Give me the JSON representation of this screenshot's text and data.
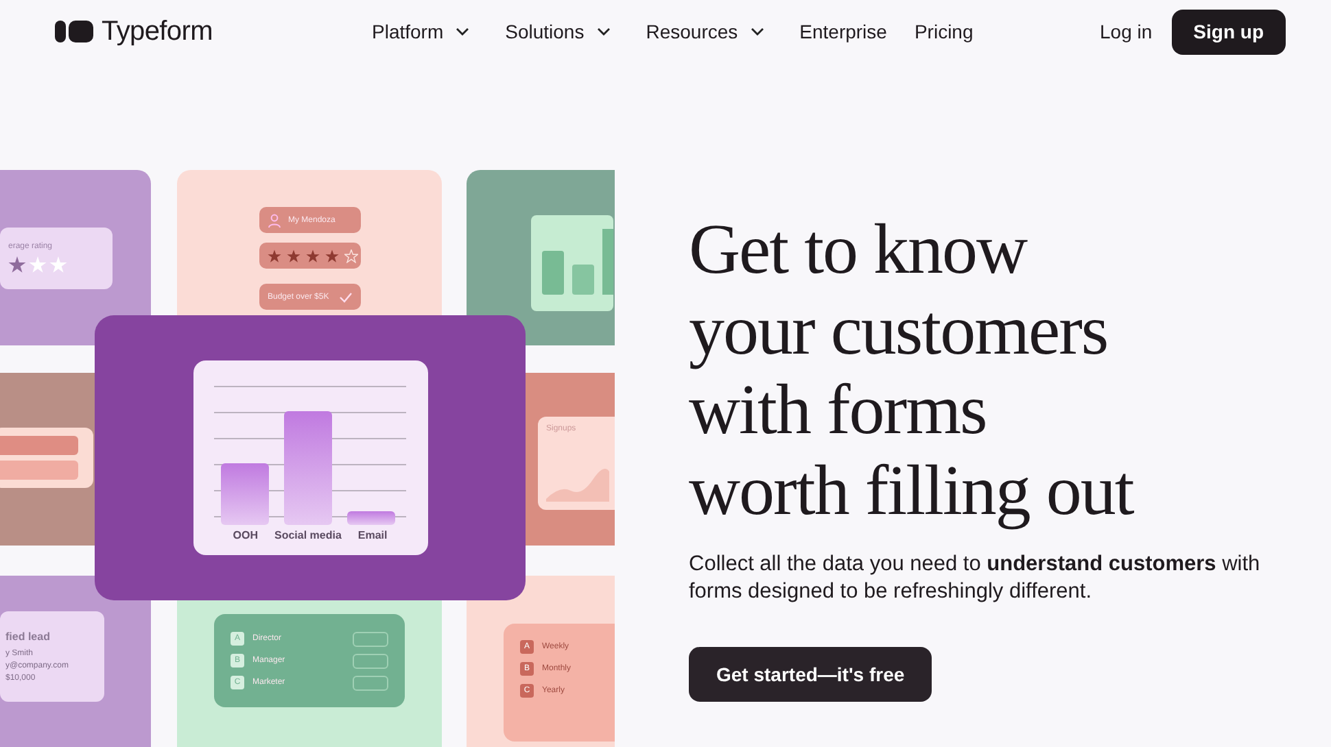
{
  "nav": {
    "logo": "Typeform",
    "menu": [
      {
        "label": "Platform",
        "dropdown": true
      },
      {
        "label": "Solutions",
        "dropdown": true
      },
      {
        "label": "Resources",
        "dropdown": true
      },
      {
        "label": "Enterprise",
        "dropdown": false
      },
      {
        "label": "Pricing",
        "dropdown": false
      }
    ],
    "login": "Log in",
    "signup": "Sign up"
  },
  "illustration": {
    "rating_card": {
      "label": "erage rating",
      "stars": 1
    },
    "profile_card": {
      "name": "My Mendoza",
      "stars": 4,
      "budget": "Budget over $5K"
    },
    "chart_card": {
      "bar_labels": [
        "OOH",
        "Social media",
        "Email"
      ]
    },
    "lead_card": {
      "title": "fied lead",
      "lines": [
        "y Smith",
        "y@company.com",
        "$10,000"
      ]
    },
    "roles_card": {
      "options": [
        {
          "key": "A",
          "label": "Director"
        },
        {
          "key": "B",
          "label": "Manager"
        },
        {
          "key": "C",
          "label": "Marketer"
        }
      ]
    },
    "signups_card": {
      "title": "Signups"
    },
    "frequency_card": {
      "options": [
        {
          "key": "A",
          "label": "Weekly"
        },
        {
          "key": "B",
          "label": "Monthly"
        },
        {
          "key": "C",
          "label": "Yearly"
        }
      ]
    }
  },
  "hero": {
    "heading_lines": [
      "Get to know",
      "your customers",
      "with forms",
      "worth filling out"
    ],
    "subtitle": "Collect all the data you need to **understand customers** with forms designed to be refreshingly different.",
    "cta": "Get started—it's free"
  }
}
